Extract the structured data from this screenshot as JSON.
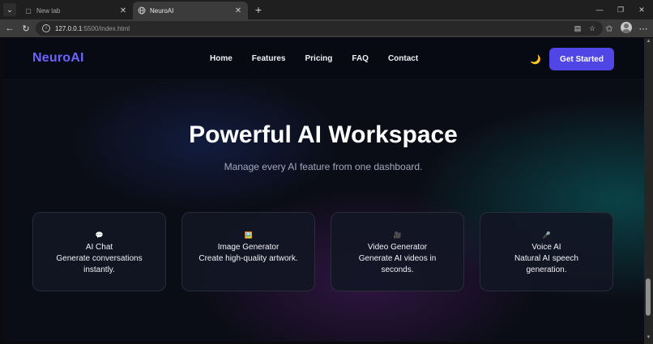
{
  "browser": {
    "tabs": [
      {
        "title": "New tab",
        "active": false
      },
      {
        "title": "NeuroAI",
        "active": true
      }
    ],
    "url_host": "127.0.0.1",
    "url_rest": ":5500/index.html"
  },
  "site": {
    "logo": "NeuroAI",
    "nav": [
      "Home",
      "Features",
      "Pricing",
      "FAQ",
      "Contact"
    ],
    "theme_icon": "moon-icon",
    "cta_label": "Get Started",
    "accent": "#4f46e5",
    "logo_color": "#6c63ff"
  },
  "hero": {
    "title": "Powerful AI Workspace",
    "subtitle": "Manage every AI feature from one dashboard."
  },
  "features": [
    {
      "icon": "💬",
      "icon_name": "chat-bubble-icon",
      "title": "AI Chat",
      "desc": "Generate conversations instantly."
    },
    {
      "icon": "🖼️",
      "icon_name": "picture-icon",
      "title": "Image Generator",
      "desc": "Create high-quality artwork."
    },
    {
      "icon": "🎥",
      "icon_name": "video-camera-icon",
      "title": "Video Generator",
      "desc": "Generate AI videos in seconds."
    },
    {
      "icon": "🎤",
      "icon_name": "microphone-icon",
      "title": "Voice AI",
      "desc": "Natural AI speech generation."
    }
  ]
}
